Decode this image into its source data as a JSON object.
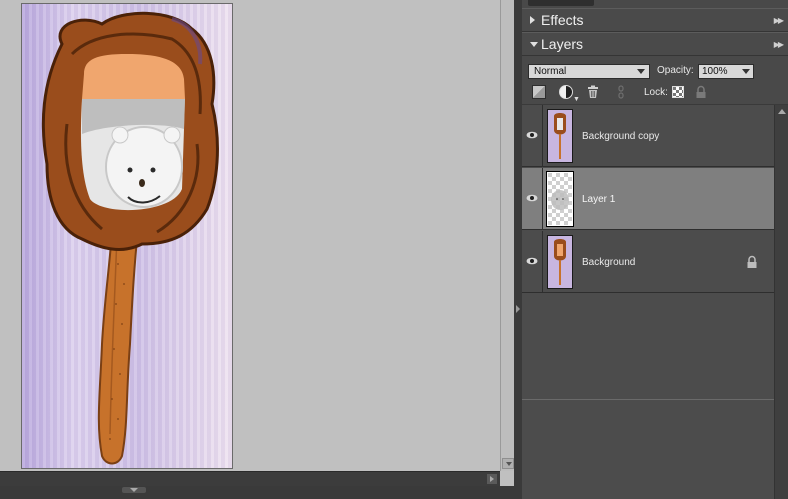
{
  "canvas": {
    "document_image": "hand-mirror-snowman-composite"
  },
  "panels": {
    "effects": {
      "title": "Effects"
    },
    "layers": {
      "title": "Layers"
    }
  },
  "layers_panel": {
    "blend_mode": "Normal",
    "opacity_label": "Opacity:",
    "opacity_value": "100%",
    "lock_label": "Lock:",
    "layers": [
      {
        "name": "Background copy",
        "visible": true,
        "selected": false,
        "locked": false
      },
      {
        "name": "Layer 1",
        "visible": true,
        "selected": true,
        "locked": false
      },
      {
        "name": "Background",
        "visible": true,
        "selected": false,
        "locked": true
      }
    ]
  },
  "colors": {
    "panel_bg": "#494949",
    "selected_row": "#7f7f7f",
    "canvas_bg": "#c0c0c0"
  },
  "icons": [
    "eye-icon",
    "new-layer-icon",
    "adjustment-layer-icon",
    "trash-icon",
    "link-icon",
    "lock-transparent-icon",
    "lock-icon"
  ]
}
